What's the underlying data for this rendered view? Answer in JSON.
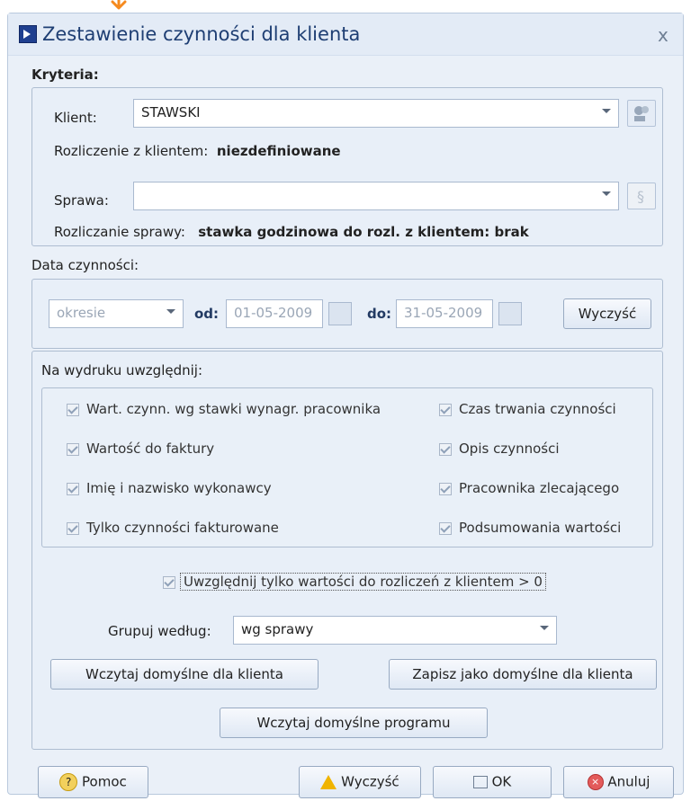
{
  "window": {
    "title": "Zestawienie czynności dla klienta",
    "close_glyph": "x"
  },
  "criteria": {
    "label": "Kryteria:",
    "client": {
      "label": "Klient:",
      "value": "STAWSKI",
      "settlement_label": "Rozliczenie z klientem:",
      "settlement_value": "niezdefiniowane"
    },
    "case": {
      "label": "Sprawa:",
      "value": "",
      "settlement_label": "Rozliczanie sprawy:",
      "settlement_value": "stawka godzinowa do rozl. z klientem: brak"
    }
  },
  "date": {
    "label": "Data czynności:",
    "period_value": "okresie",
    "from_label": "od:",
    "from_value": "01-05-2009",
    "to_label": "do:",
    "to_value": "31-05-2009",
    "clear_label": "Wyczyść"
  },
  "print": {
    "label": "Na wydruku uwzględnij:",
    "options_left": [
      {
        "label": "Wart. czynn. wg stawki wynagr. pracownika",
        "checked": true
      },
      {
        "label": "Wartość do faktury",
        "checked": true
      },
      {
        "label": "Imię i nazwisko wykonawcy",
        "checked": true
      },
      {
        "label": "Tylko czynności fakturowane",
        "checked": true
      }
    ],
    "options_right": [
      {
        "label": "Czas trwania czynności",
        "checked": true
      },
      {
        "label": "Opis czynności",
        "checked": true
      },
      {
        "label": "Pracownika zlecającego",
        "checked": true
      },
      {
        "label": "Podsumowania wartości",
        "checked": true
      }
    ],
    "only_positive_label": "Uwzględnij tylko wartości do rozliczeń z klientem  > 0",
    "group_label": "Grupuj według:",
    "group_value": "wg sprawy",
    "load_client_defaults": "Wczytaj domyślne dla klienta",
    "save_client_defaults": "Zapisz jako domyślne dla klienta",
    "load_program_defaults": "Wczytaj domyślne programu"
  },
  "footer": {
    "help": "Pomoc",
    "clear": "Wyczyść",
    "ok": "OK",
    "cancel": "Anuluj"
  }
}
